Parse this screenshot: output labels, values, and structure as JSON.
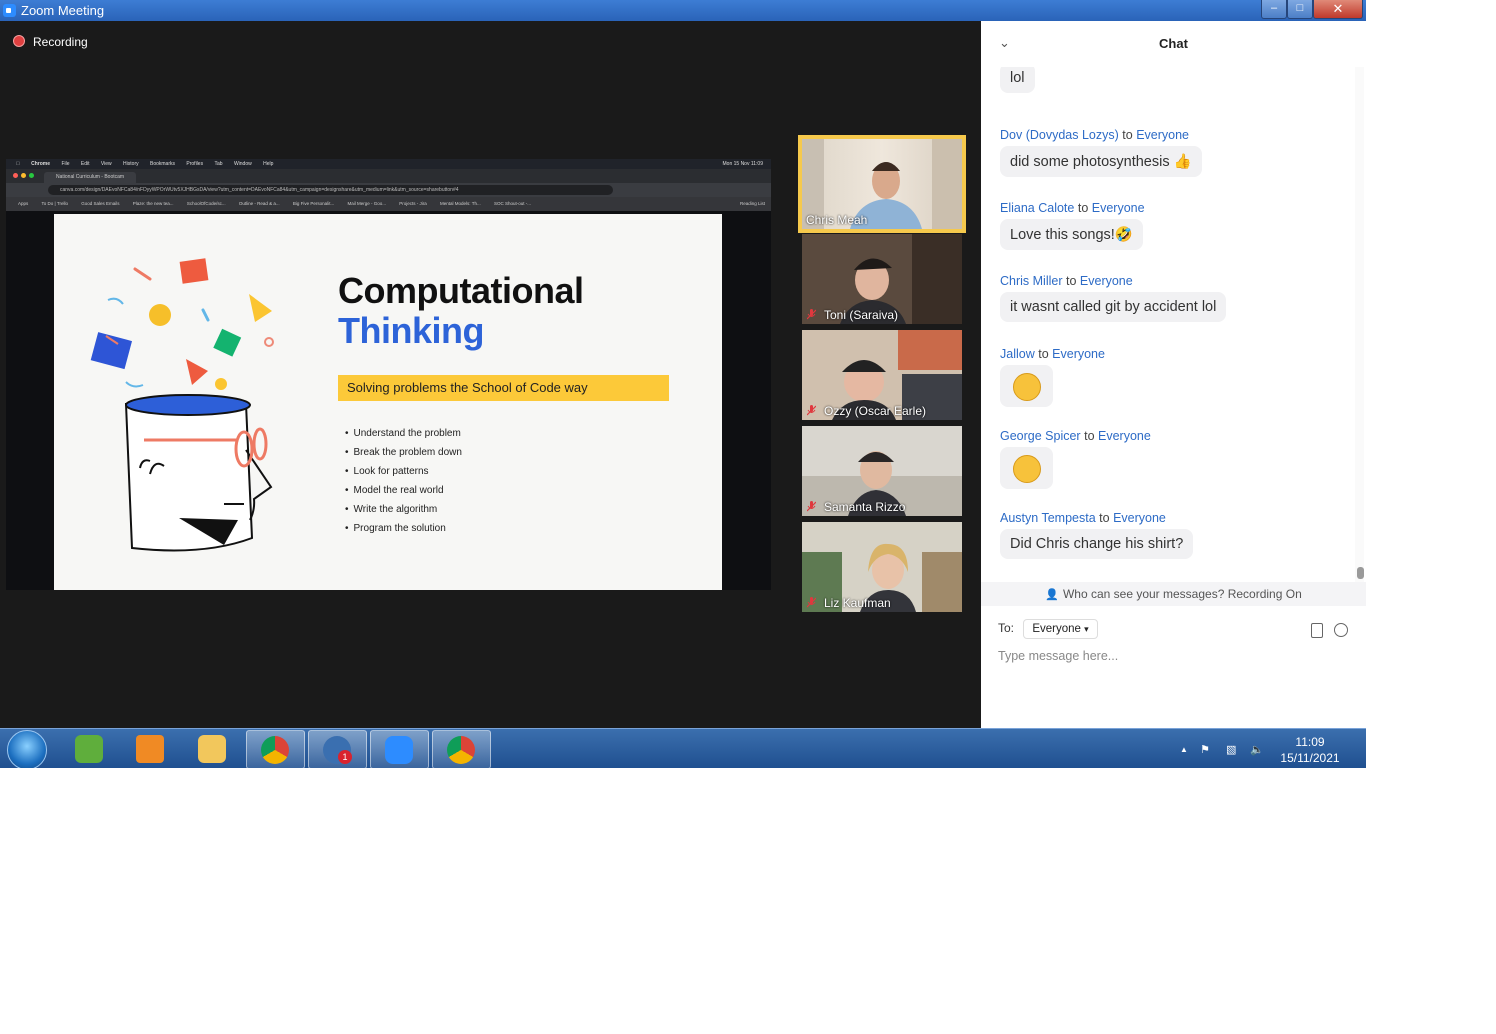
{
  "window": {
    "title": "Zoom Meeting",
    "minimize": "–",
    "maximize": "□",
    "close": "✕"
  },
  "recording": {
    "label": "Recording"
  },
  "shared_screen": {
    "menubar": [
      "Chrome",
      "File",
      "Edit",
      "View",
      "History",
      "Bookmarks",
      "Profiles",
      "Tab",
      "Window",
      "Help"
    ],
    "menubar_clock": "Mon 15 Nov 11:09",
    "tab_title": "National Curriculum - Bootcam",
    "url": "canva.com/design/DAEvoNFCa84/nFDyyWPOrWUtv5XJHBGsDA/view?utm_content=DAEvoNFCa84&utm_campaign=designshare&utm_medium=link&utm_source=sharebutton#4",
    "bookmarks": [
      "Apps",
      "To Do | Trello",
      "Good Sales Emails",
      "Plaze: the new tea...",
      "SchoolOfCode/sc...",
      "Outline - Read & a...",
      "Big Five Personalit...",
      "Mail Merge - Goo...",
      "Projects - Jira",
      "Mental Models: Th...",
      "SOC Shout-out -..."
    ],
    "reading_list": "Reading List",
    "slide": {
      "title_line1": "Computational",
      "title_line2": "Thinking",
      "subtitle": "Solving problems the School of Code way",
      "bullets": [
        "Understand the problem",
        "Break the problem down",
        "Look for patterns",
        "Model the real world",
        "Write the algorithm",
        "Program the solution"
      ]
    }
  },
  "participants": [
    {
      "name": "Chris Meah",
      "active_speaker": true,
      "muted": false
    },
    {
      "name": "Toni (Saraiva)",
      "muted": true
    },
    {
      "name": "Ozzy (Oscar Earle)",
      "muted": true
    },
    {
      "name": "Samanta Rizzo",
      "muted": true
    },
    {
      "name": "Liz Kaufman",
      "muted": true
    }
  ],
  "chat": {
    "title": "Chat",
    "messages": [
      {
        "sender": "",
        "to": "",
        "text": "lol"
      },
      {
        "sender": "Dov (Dovydas Lozys)",
        "to": "Everyone",
        "text": "did some photosynthesis 👍"
      },
      {
        "sender": "Eliana Calote",
        "to": "Everyone",
        "text": "Love this songs!🤣"
      },
      {
        "sender": "Chris Miller",
        "to": "Everyone",
        "text": "it wasnt called git by accident lol"
      },
      {
        "sender": "Jallow",
        "to": "Everyone",
        "text": "🤣"
      },
      {
        "sender": "George Spicer",
        "to": "Everyone",
        "text": "🤣"
      },
      {
        "sender": "Austyn Tempesta",
        "to": "Everyone",
        "text": "Did Chris change his shirt?"
      }
    ],
    "to_word": "to",
    "privacy_notice": "Who can see your messages? Recording On",
    "to_label": "To:",
    "to_value": "Everyone",
    "input_placeholder": "Type message here..."
  },
  "taskbar": {
    "time": "11:09",
    "date": "15/11/2021",
    "notification_count": "1",
    "apps": [
      "evernote",
      "media-player",
      "file-explorer",
      "chrome",
      "thunderbird",
      "zoom",
      "chrome-profile"
    ]
  }
}
